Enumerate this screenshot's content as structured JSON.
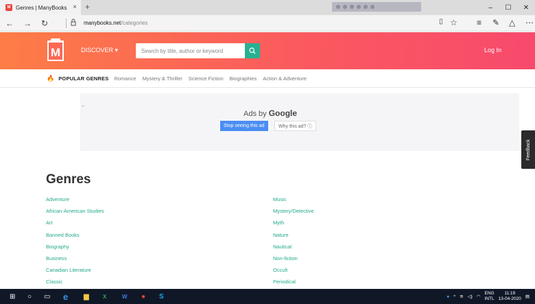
{
  "browser": {
    "tab_title": "Genres | ManyBooks",
    "tab_close": "×",
    "new_tab": "+",
    "url_domain": "manybooks.net",
    "url_path": "/categories",
    "window_controls": [
      "–",
      "☐",
      "✕"
    ]
  },
  "header": {
    "logo_letter": "M",
    "discover_label": "DISCOVER ▾",
    "search_placeholder": "Search by title, author or keyword",
    "login_label": "Log In"
  },
  "genre_nav": {
    "popular_label": "POPULAR GENRES",
    "items": [
      "Romance",
      "Mystery & Thriller",
      "Science Fiction",
      "Biographies",
      "Action & Adventure"
    ]
  },
  "ad": {
    "back_arrow": "←",
    "ads_by": "Ads by",
    "brand": "Google",
    "stop_label": "Stop seeing this ad",
    "why_label": "Why this ad? ⓘ"
  },
  "feedback_label": "Feedback",
  "genres": {
    "title": "Genres",
    "left": [
      "Adventure",
      "African-American Studies",
      "Art",
      "Banned Books",
      "Biography",
      "Business",
      "Canadian Literature",
      "Classic"
    ],
    "right": [
      "Music",
      "Mystery/Detective",
      "Myth",
      "Nature",
      "Nautical",
      "Non-fiction",
      "Occult",
      "Periodical"
    ]
  },
  "taskbar": {
    "lang_top": "ENG",
    "lang_bottom": "INTL",
    "time": "11:19",
    "date": "13-04-2020"
  },
  "colors": {
    "header_start": "#fd7d46",
    "header_end": "#f84a6d",
    "accent_green": "#22a98a",
    "search_button": "#27b092",
    "stop_button": "#4a8df3"
  }
}
